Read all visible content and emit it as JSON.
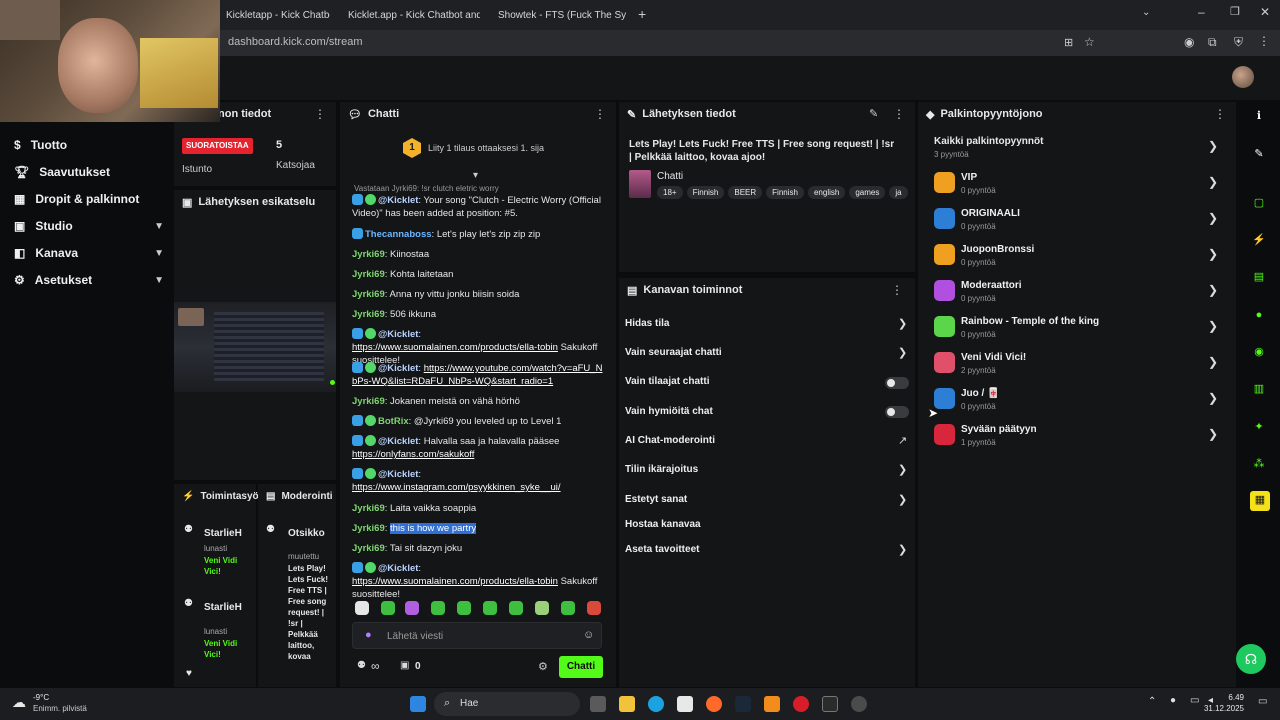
{
  "browser": {
    "tabs": [
      {
        "title": "Kickletapp - Kick Chatbot and"
      },
      {
        "title": "Kicklet.app - Kick Chatbot and"
      },
      {
        "title": "Showtek - FTS (Fuck The Sy"
      }
    ],
    "url": "dashboard.kick.com/stream"
  },
  "sidebar": {
    "items": [
      {
        "label": "Tuotto",
        "icon": "dollar-icon"
      },
      {
        "label": "Saavutukset",
        "icon": "trophy-icon"
      },
      {
        "label": "Dropit & palkinnot",
        "icon": "gift-icon"
      },
      {
        "label": "Studio",
        "icon": "video-icon"
      },
      {
        "label": "Kanava",
        "icon": "broadcast-icon"
      },
      {
        "label": "Asetukset",
        "icon": "gear-icon"
      }
    ]
  },
  "session": {
    "title_partial": "non tiedot",
    "live_label": "SUORATOISTAA",
    "viewers": "5",
    "session_label": "Istunto",
    "viewers_label": "Katsojaa"
  },
  "preview": {
    "title": "Lähetyksen esikatselu"
  },
  "activity": {
    "title": "Toimintasyöt",
    "moderation_title": "Moderointi",
    "items": [
      {
        "user": "StarlieH",
        "action": "lunasti",
        "reward": "Veni Vidi Vici!"
      },
      {
        "user": "StarlieH",
        "action": "lunasti",
        "reward": "Veni Vidi Vici!"
      }
    ],
    "mod_item": {
      "label": "Otsikko",
      "action": "muutettu",
      "text": "Lets Play! Lets Fuck! Free TTS | Free song request! | !sr | Pelkkää laittoo, kovaa"
    }
  },
  "chat": {
    "title": "Chatti",
    "rank_number": "1",
    "rank_text": "Liity 1 tilaus ottaaksesi 1. sija",
    "reply_hint": "Vastataan Jyrki69: !sr clutch eletric worry",
    "messages": [
      {
        "user": "@Kicklet",
        "text": "Your song \"Clutch - Electric Worry (Official Video)\" has been added at position: #5."
      },
      {
        "user": "Thecannaboss",
        "text": "Let's play let's zip zip zip"
      },
      {
        "user": "Jyrki69",
        "text": "Kiinostaa"
      },
      {
        "user": "Jyrki69",
        "text": "Kohta laitetaan"
      },
      {
        "user": "Jyrki69",
        "text": "Anna ny vittu jonku biisin soida"
      },
      {
        "user": "Jyrki69",
        "text": "506 ikkuna"
      },
      {
        "user": "@Kicklet",
        "link": "https://www.suomalainen.com/products/ella-tobin",
        "text": "Sakukoff suosittelee!"
      },
      {
        "user": "@Kicklet",
        "link": "https://www.youtube.com/watch?v=aFU_NbPs-WQ&list=RDaFU_NbPs-WQ&start_radio=1",
        "text": ""
      },
      {
        "user": "Jyrki69",
        "text": "Jokanen meistä on vähä hörhö"
      },
      {
        "user": "BotRix",
        "text": "@Jyrki69 you leveled up to Level 1"
      },
      {
        "user": "@Kicklet",
        "text": "Halvalla saa ja halavalla pääsee",
        "link": "https://onlyfans.com/sakukoff"
      },
      {
        "user": "@Kicklet",
        "link": "https://www.instagram.com/psyykkinen_syke__ui/",
        "text": ""
      },
      {
        "user": "Jyrki69",
        "text": "Laita vaikka soappia"
      },
      {
        "user": "Jyrki69",
        "text": "this is how we partry"
      },
      {
        "user": "Jyrki69",
        "text": "Tai sit dazyn joku"
      },
      {
        "user": "@Kicklet",
        "link": "https://www.suomalainen.com/products/ella-tobin",
        "text": "Sakukoff suosittelee!"
      }
    ],
    "input_placeholder": "Lähetä viesti",
    "points": "∞",
    "gift_count": "0",
    "send_label": "Chatti"
  },
  "stream_info": {
    "title": "Lähetyksen tiedot",
    "stream_title": "Lets Play! Lets Fuck! Free TTS | Free song request! | !sr | Pelkkää laittoo, kovaa ajoo!",
    "category": "Chatti",
    "tags": [
      "18+",
      "Finnish",
      "BEER",
      "Finnish",
      "english",
      "games",
      "ja"
    ]
  },
  "channel_actions": {
    "title": "Kanavan toiminnot",
    "items": [
      {
        "label": "Hidas tila",
        "control": "chevron"
      },
      {
        "label": "Vain seuraajat chatti",
        "control": "chevron"
      },
      {
        "label": "Vain tilaajat chatti",
        "control": "toggle"
      },
      {
        "label": "Vain hymiöitä chat",
        "control": "toggle"
      },
      {
        "label": "AI Chat-moderointi",
        "control": "external"
      },
      {
        "label": "Tilin ikärajoitus",
        "control": "chevron"
      },
      {
        "label": "Estetyt sanat",
        "control": "chevron"
      },
      {
        "label": "Hostaa kanavaa",
        "control": "none"
      },
      {
        "label": "Aseta tavoitteet",
        "control": "chevron"
      }
    ]
  },
  "rewards": {
    "title": "Palkintopyyntöjono",
    "all_label": "Kaikki palkintopyynnöt",
    "all_count": "3 pyyntöä",
    "items": [
      {
        "name": "VIP",
        "count": "0 pyyntöä",
        "color": "#f0a020"
      },
      {
        "name": "ORIGINAALI",
        "count": "0 pyyntöä",
        "color": "#2d7fd6"
      },
      {
        "name": "JuoponBronssi",
        "count": "0 pyyntöä",
        "color": "#f0a020"
      },
      {
        "name": "Moderaattori",
        "count": "0 pyyntöä",
        "color": "#b04fe0"
      },
      {
        "name": "Rainbow - Temple of the king",
        "count": "0 pyyntöä",
        "color": "#5bd64a"
      },
      {
        "name": "Veni Vidi Vici!",
        "count": "2 pyyntöä",
        "color": "#e0506b"
      },
      {
        "name": "Juo / 🀄",
        "count": "0 pyyntöä",
        "color": "#2d7fd6"
      },
      {
        "name": "Syvään päätyyn",
        "count": "1 pyyntöä",
        "color": "#d8263c"
      }
    ]
  },
  "taskbar": {
    "weather_temp": "-9°C",
    "weather_desc": "Enimm. pilvistä",
    "search_label": "Hae",
    "time": "6.49",
    "date": "31.12.2025"
  },
  "colors": {
    "accent": "#53fc18",
    "live": "#e5232f",
    "panel": "#141517"
  }
}
